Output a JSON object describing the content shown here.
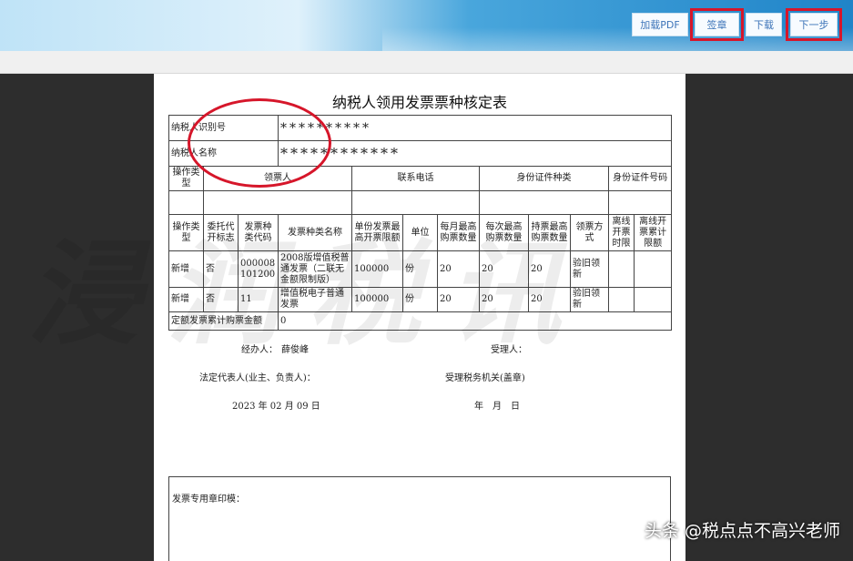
{
  "toolbar": {
    "load_pdf": "加载PDF",
    "sign": "签章",
    "download": "下载",
    "next": "下一步"
  },
  "form": {
    "title": "纳税人领用发票票种核定表",
    "taxpayer_id_label": "纳税人识别号",
    "taxpayer_id_value": "**********",
    "taxpayer_name_label": "纳税人名称",
    "taxpayer_name_value": "************",
    "holder_headers": [
      "操作类型",
      "领票人",
      "联系电话",
      "身份证件种类",
      "身份证件号码"
    ],
    "invoice_headers": [
      "操作类型",
      "委托代开标志",
      "发票种类代码",
      "发票种类名称",
      "单份发票最高开票限额",
      "单位",
      "每月最高购票数量",
      "每次最高购票数量",
      "持票最高购票数量",
      "领票方式",
      "离线开票时限",
      "离线开票累计限额"
    ],
    "rows": [
      [
        "新增",
        "否",
        "000008101200",
        "2008版增值税普通发票（二联无金额限制版）",
        "100000",
        "份",
        "20",
        "20",
        "20",
        "验旧领新",
        "",
        ""
      ],
      [
        "新增",
        "否",
        "11",
        "增值税电子普通发票",
        "100000",
        "份",
        "20",
        "20",
        "20",
        "验旧领新",
        "",
        ""
      ]
    ],
    "quota_label": "定额发票累计购票金额",
    "quota_value": "0",
    "handler_label": "经办人：",
    "handler_value": "薛俊峰",
    "receiver_label": "受理人：",
    "legal_rep_label": "法定代表人(业主、负责人)：",
    "tax_office_label": "受理税务机关(盖章)",
    "date_left": "2023 年 02 月 09 日",
    "date_right": "年　月　日",
    "seal_label": "发票专用章印模："
  },
  "watermark": "浸润税讯",
  "credit": "头条 @税点点不高兴老师",
  "colors": {
    "highlight": "#d6162a",
    "toolbar_text": "#3d74b8"
  }
}
